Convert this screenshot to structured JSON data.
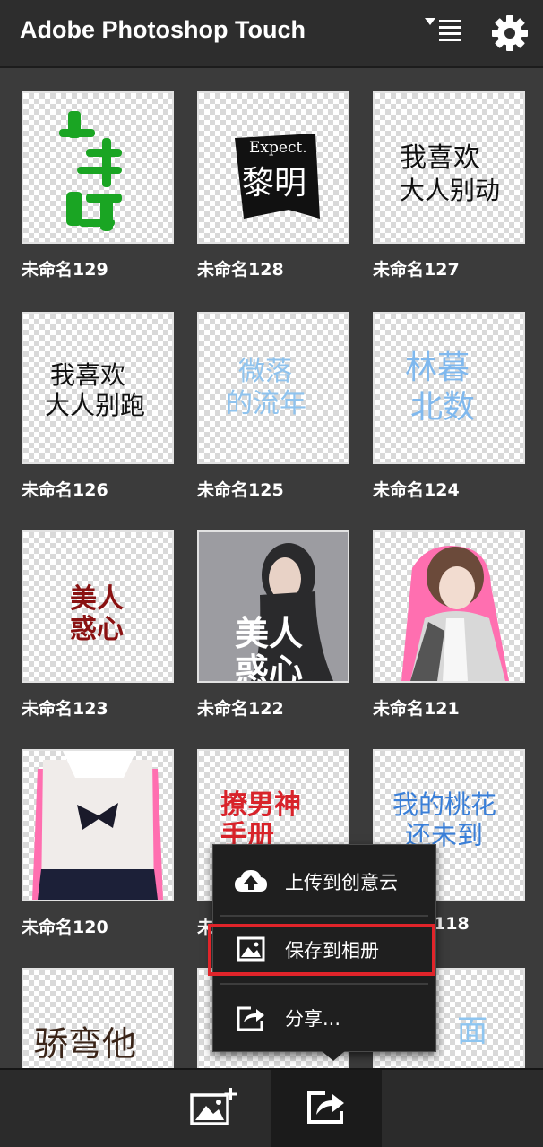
{
  "header": {
    "title": "Adobe Photoshop Touch",
    "sort_icon": "sort-list-icon",
    "settings_icon": "gear-icon"
  },
  "projects": [
    {
      "label": "未命名129"
    },
    {
      "label": "未命名128"
    },
    {
      "label": "未命名127"
    },
    {
      "label": "未命名126"
    },
    {
      "label": "未命名125"
    },
    {
      "label": "未命名124"
    },
    {
      "label": "未命名123"
    },
    {
      "label": "未命名122"
    },
    {
      "label": "未命名121"
    },
    {
      "label": "未命名120"
    },
    {
      "label": "未"
    },
    {
      "label": "118"
    },
    {
      "label": ""
    },
    {
      "label": ""
    },
    {
      "label": ""
    }
  ],
  "thumbnails": {
    "t128_text": "Expect.",
    "t128_main": "黎明",
    "t127_main": "我喜欢",
    "t127_sub": "大人别动",
    "t126_main": "我喜欢",
    "t126_sub": "大人别跑",
    "t125_main": "微落",
    "t125_sub": "的流年",
    "t124_main": "林暮",
    "t124_sub": "北数",
    "t123_main": "美人",
    "t123_sub": "惑心",
    "t122_main": "美人",
    "t122_sub": "惑心",
    "t119_main": "撩男神",
    "t119_sub": "手册",
    "t118_main": "我的桃花",
    "t118_sub": "还未到",
    "t117_main": "骄弯他",
    "t116_main": "面"
  },
  "menu": {
    "items": [
      {
        "label": "上传到创意云",
        "icon": "cloud-upload-icon"
      },
      {
        "label": "保存到相册",
        "icon": "image-icon"
      },
      {
        "label": "分享...",
        "icon": "share-icon"
      }
    ],
    "highlight_color": "#e0242a"
  },
  "bottombar": {
    "add_icon": "add-image-icon",
    "share_icon": "share-icon"
  }
}
